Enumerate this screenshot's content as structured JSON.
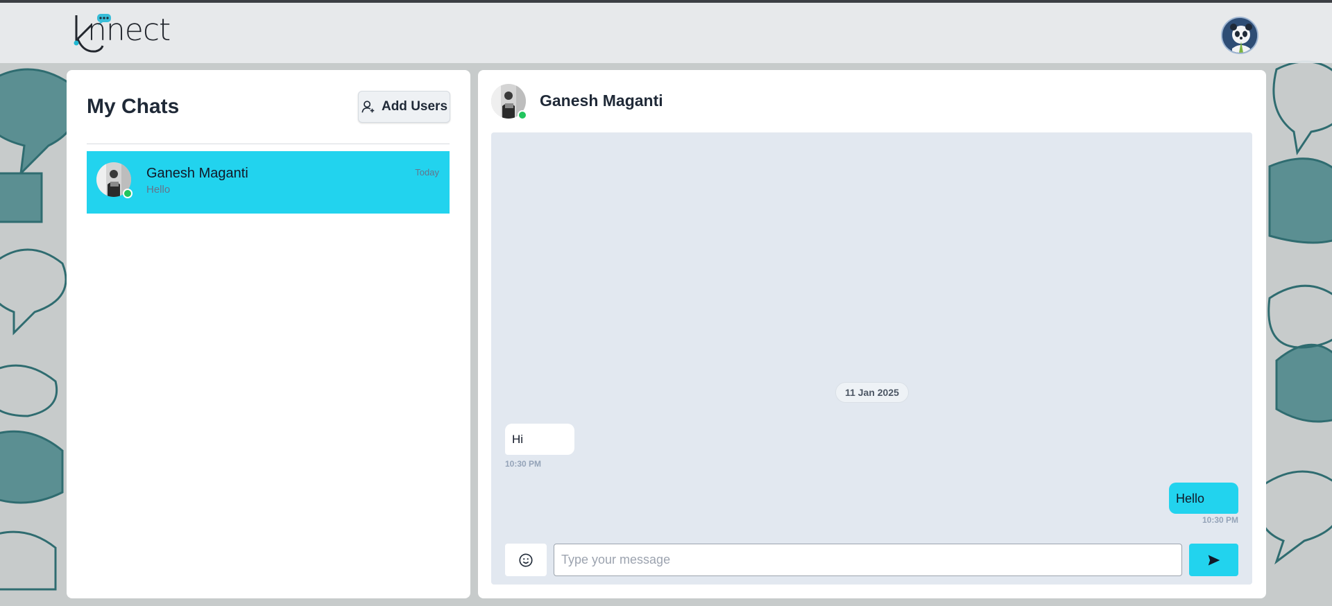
{
  "app": {
    "logo_text": "knnect",
    "accent_color": "#22d3ee",
    "online_color": "#22c55e"
  },
  "header": {
    "profile_avatar_icon": "panda-avatar-icon"
  },
  "sidebar": {
    "title": "My Chats",
    "add_users_label": "Add Users",
    "add_users_icon": "user-plus-icon",
    "chats": [
      {
        "name": "Ganesh Maganti",
        "last_message": "Hello",
        "time": "Today",
        "online": true,
        "selected": true
      }
    ]
  },
  "conversation": {
    "contact_name": "Ganesh Maganti",
    "online": true,
    "date_separator": "11 Jan 2025",
    "messages": [
      {
        "direction": "incoming",
        "text": "Hi",
        "time": "10:30 PM"
      },
      {
        "direction": "outgoing",
        "text": "Hello",
        "time": "10:30 PM"
      }
    ],
    "input": {
      "placeholder": "Type your message",
      "value": ""
    },
    "emoji_icon": "smiley-icon",
    "send_icon": "send-icon"
  }
}
